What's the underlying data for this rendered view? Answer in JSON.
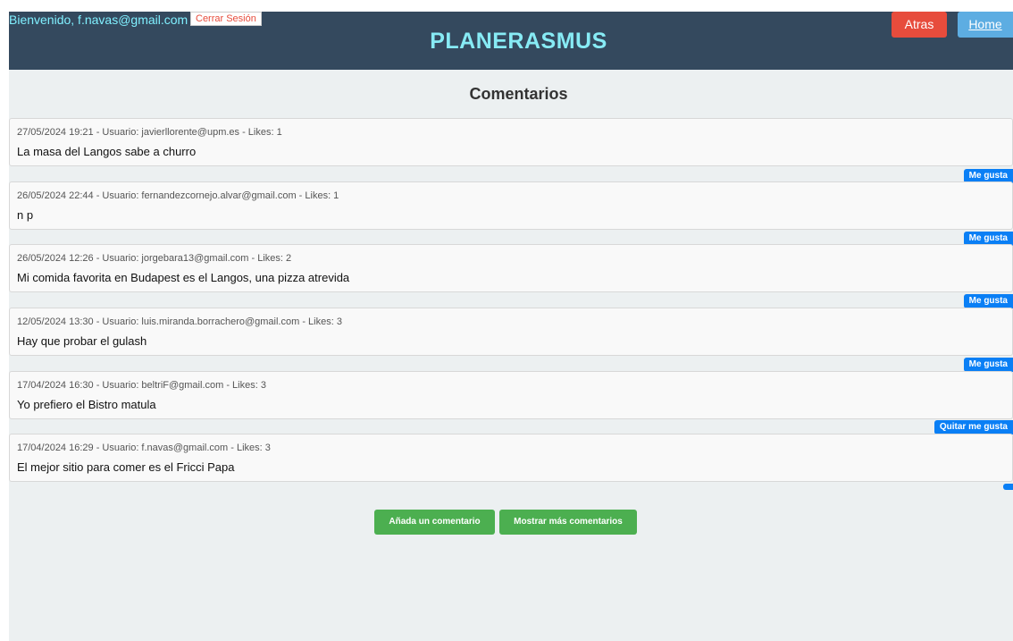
{
  "header": {
    "welcome": "Bienvenido, f.navas@gmail.com",
    "logout_label": "Cerrar Sesión",
    "app_title": "PLANERASMUS",
    "back_label": "Atras",
    "home_label": "Home"
  },
  "section_title": "Comentarios",
  "comments": [
    {
      "meta": "27/05/2024 19:21 - Usuario: javierllorente@upm.es - Likes: 1",
      "text": "La masa del Langos sabe a churro",
      "like_label": "Me gusta"
    },
    {
      "meta": "26/05/2024 22:44 - Usuario: fernandezcornejo.alvar@gmail.com - Likes: 1",
      "text": "n p",
      "like_label": "Me gusta"
    },
    {
      "meta": "26/05/2024 12:26 - Usuario: jorgebara13@gmail.com - Likes: 2",
      "text": "Mi comida favorita en Budapest es el Langos, una pizza atrevida",
      "like_label": "Me gusta"
    },
    {
      "meta": "12/05/2024 13:30 - Usuario: luis.miranda.borrachero@gmail.com - Likes: 3",
      "text": "Hay que probar el gulash",
      "like_label": "Me gusta"
    },
    {
      "meta": "17/04/2024 16:30 - Usuario: beltriF@gmail.com - Likes: 3",
      "text": "Yo prefiero el Bistro matula",
      "like_label": "Quitar me gusta"
    },
    {
      "meta": "17/04/2024 16:29 - Usuario: f.navas@gmail.com - Likes: 3",
      "text": "El mejor sitio para comer es el Fricci Papa",
      "like_label": ""
    }
  ],
  "actions": {
    "add_comment_label": "Añada un comentario",
    "show_more_label": "Mostrar más comentarios"
  },
  "colors": {
    "header_bg": "#34495e",
    "title": "#87ebf5",
    "back_button": "#e74c3c",
    "home_button": "#5dade2",
    "like_button": "#0a7ff5",
    "action_button": "#4caf50",
    "page_bg": "#ecf0f1"
  }
}
